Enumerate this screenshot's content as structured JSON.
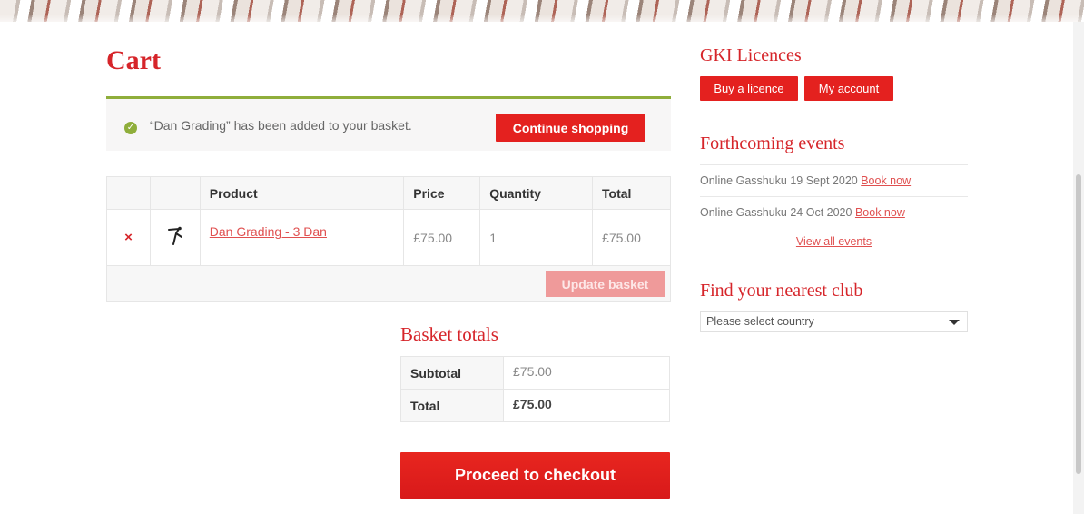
{
  "cart": {
    "title": "Cart",
    "notice": {
      "message": "“Dan Grading” has been added to your basket.",
      "continue_label": "Continue shopping"
    },
    "columns": [
      "Product",
      "Price",
      "Quantity",
      "Total"
    ],
    "items": [
      {
        "remove_symbol": "×",
        "product": "Dan Grading - 3 Dan",
        "price": "£75.00",
        "quantity": "1",
        "total": "£75.00"
      }
    ],
    "update_label": "Update basket"
  },
  "totals": {
    "title": "Basket totals",
    "subtotal_label": "Subtotal",
    "subtotal_value": "£75.00",
    "total_label": "Total",
    "total_value": "£75.00",
    "checkout_label": "Proceed to checkout"
  },
  "sidebar": {
    "licences": {
      "title": "GKI Licences",
      "buy_label": "Buy a licence",
      "account_label": "My account"
    },
    "events": {
      "title": "Forthcoming events",
      "items": [
        {
          "name": "Online Gasshuku 19 Sept 2020",
          "link": "Book now"
        },
        {
          "name": "Online Gasshuku 24 Oct 2020",
          "link": "Book now"
        }
      ],
      "view_all": "View all events"
    },
    "club": {
      "title": "Find your nearest club",
      "select_value": "Please select country"
    }
  },
  "colors": {
    "brand_red": "#d6252a",
    "button_red": "#e4211f",
    "success_green": "#8fae3b"
  }
}
